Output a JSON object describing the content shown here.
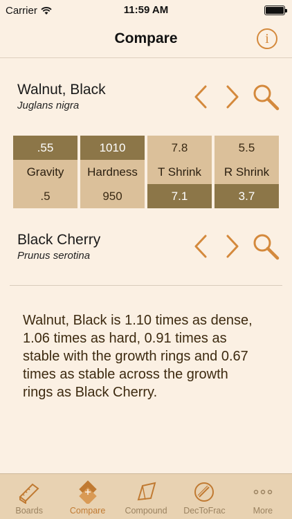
{
  "status": {
    "carrier": "Carrier",
    "time": "11:59 AM"
  },
  "nav": {
    "title": "Compare",
    "info_glyph": "i"
  },
  "wood1": {
    "name": "Walnut, Black",
    "scientific": "Juglans nigra"
  },
  "wood2": {
    "name": "Black Cherry",
    "scientific": "Prunus serotina"
  },
  "stats": [
    {
      "label": "Gravity",
      "top": ".55",
      "bottom": ".5",
      "top_style": "dark",
      "bottom_style": "light"
    },
    {
      "label": "Hardness",
      "top": "1010",
      "bottom": "950",
      "top_style": "dark",
      "bottom_style": "light"
    },
    {
      "label": "T Shrink",
      "top": "7.8",
      "bottom": "7.1",
      "top_style": "light",
      "bottom_style": "dark"
    },
    {
      "label": "R Shrink",
      "top": "5.5",
      "bottom": "3.7",
      "top_style": "light",
      "bottom_style": "dark"
    }
  ],
  "summary": "Walnut, Black is 1.10 times as dense, 1.06 times as hard, 0.91 times as stable with the growth rings and 0.67 times as stable across the growth rings as Black Cherry.",
  "tabs": [
    {
      "label": "Boards",
      "icon": "boards-icon",
      "active": false
    },
    {
      "label": "Compare",
      "icon": "compare-icon",
      "active": true
    },
    {
      "label": "Compound",
      "icon": "compound-icon",
      "active": false
    },
    {
      "label": "DecToFrac",
      "icon": "dectofrac-icon",
      "active": false
    },
    {
      "label": "More",
      "icon": "more-icon",
      "active": false
    }
  ],
  "colors": {
    "accent": "#d4893c",
    "dark_cell": "#8c7648",
    "light_cell": "#dbc09a",
    "background": "#fbf0e3",
    "tab_bar": "#e8d2b2"
  }
}
